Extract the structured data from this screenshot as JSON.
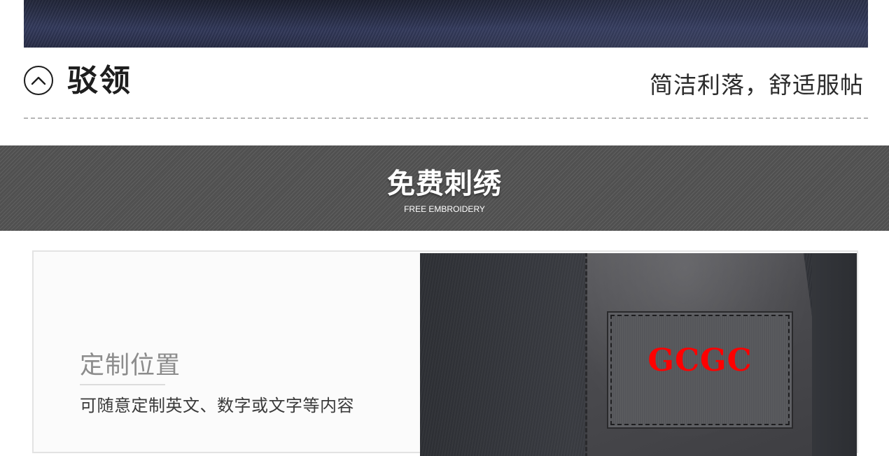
{
  "collar": {
    "title": "驳领",
    "description": "简洁利落，舒适服帖",
    "icon": "chevron-up-icon"
  },
  "banner": {
    "title": "免费刺绣",
    "subtitle": "FREE EMBROIDERY",
    "pattern_color": "#505050"
  },
  "customization": {
    "title": "定制位置",
    "description": "可随意定制英文、数字或文字等内容",
    "embroidery_sample": "GCGC",
    "embroidery_color": "#ff0000"
  }
}
